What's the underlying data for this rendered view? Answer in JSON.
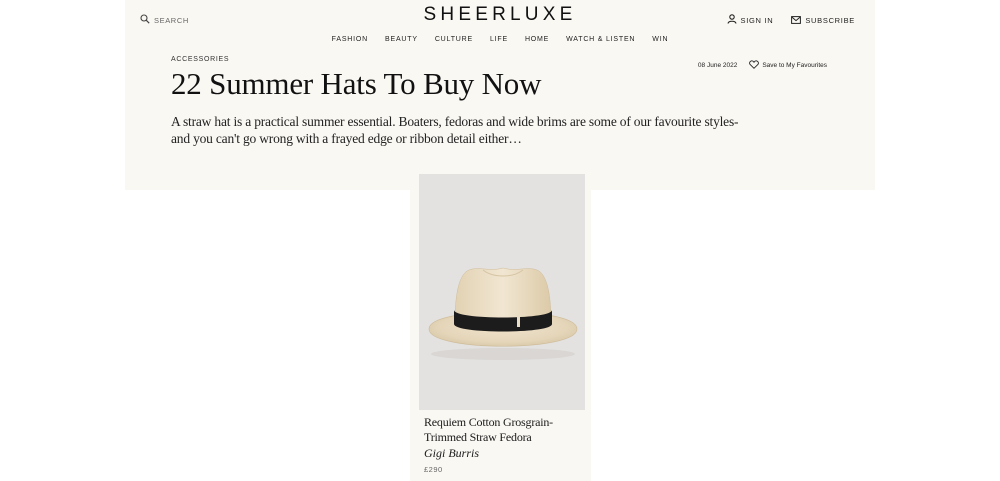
{
  "header": {
    "search_label": "SEARCH",
    "logo": "SHEERLUXE",
    "sign_in_label": "SIGN IN",
    "subscribe_label": "SUBSCRIBE"
  },
  "nav": {
    "items": [
      "FASHION",
      "BEAUTY",
      "CULTURE",
      "LIFE",
      "HOME",
      "WATCH & LISTEN",
      "WIN"
    ]
  },
  "article": {
    "category": "ACCESSORIES",
    "date": "08 June 2022",
    "save_label": "Save to My Favourites",
    "title": "22 Summer Hats To Buy Now",
    "standfirst": "A straw hat is a practical summer essential. Boaters, fedoras and wide brims are some of our favourite styles- and you can't go wrong with a frayed edge or ribbon detail either…"
  },
  "product": {
    "name": "Requiem Cotton Grosgrain-Trimmed Straw Fedora",
    "brand": "Gigi Burris",
    "price": "£290"
  },
  "icons": {
    "search": "search-icon",
    "sign_in": "user-icon",
    "subscribe": "envelope-icon",
    "save": "heart-icon"
  },
  "colors": {
    "panel_background": "#faf8f3",
    "image_background": "#e3e2e0",
    "text": "#111111",
    "hat_straw": "#e7d9bf",
    "hat_band": "#1c1c1c"
  }
}
